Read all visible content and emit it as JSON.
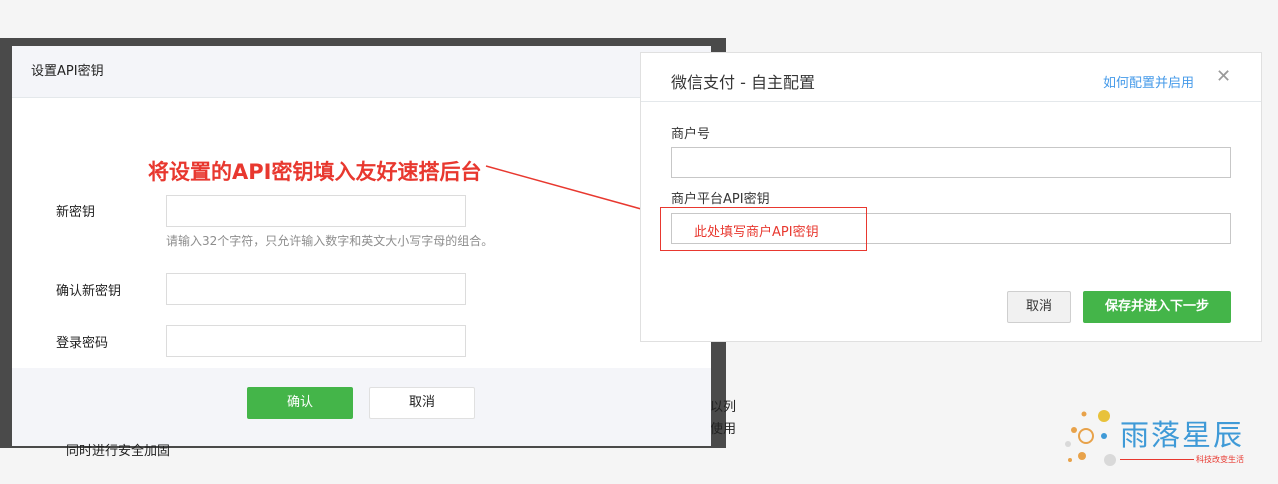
{
  "left_modal": {
    "title": "设置API密钥",
    "annotation": "将设置的API密钥填入友好速搭后台",
    "new_key_label": "新密钥",
    "new_key_hint": "请输入32个字符，只允许输入数字和英文大小写字母的组合。",
    "confirm_key_label": "确认新密钥",
    "login_password_label": "登录密码",
    "confirm_button": "确认",
    "cancel_button": "取消"
  },
  "background": {
    "line1": "同时进行安全加固",
    "side1": "以列",
    "side2": "使用"
  },
  "right_modal": {
    "title": "微信支付 - 自主配置",
    "help_link": "如何配置并启用",
    "merchant_id_label": "商户号",
    "api_key_label": "商户平台API密钥",
    "api_key_annotation": "此处填写商户API密钥",
    "cancel_button": "取消",
    "save_button": "保存并进入下一步"
  },
  "logo": {
    "name": "雨落星辰",
    "slogan": "科技改变生活"
  },
  "colors": {
    "green": "#44b549",
    "annotation_red": "#e8382f",
    "link_blue": "#459ae9"
  }
}
